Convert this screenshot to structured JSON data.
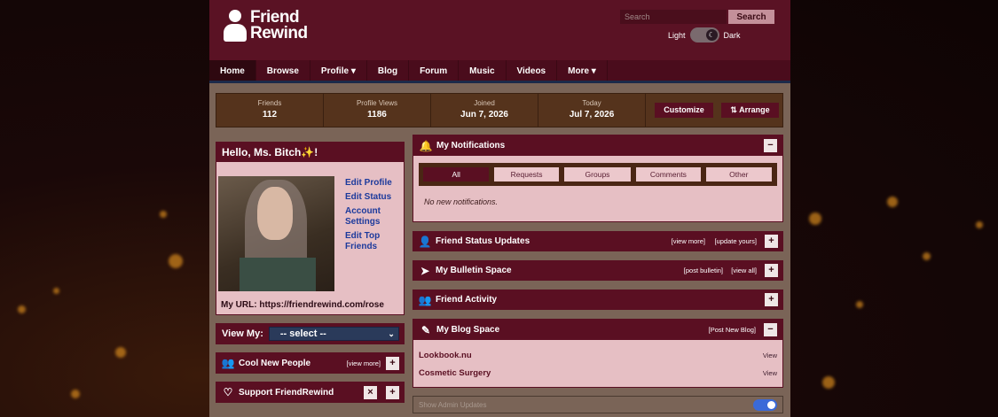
{
  "logo": {
    "line1": "Friend",
    "line2": "Rewind"
  },
  "search": {
    "placeholder": "Search",
    "button": "Search"
  },
  "theme": {
    "light": "Light",
    "dark": "Dark",
    "knob_glyph": "☾"
  },
  "nav": [
    {
      "label": "Home"
    },
    {
      "label": "Browse"
    },
    {
      "label": "Profile ▾"
    },
    {
      "label": "Blog"
    },
    {
      "label": "Forum"
    },
    {
      "label": "Music"
    },
    {
      "label": "Videos"
    },
    {
      "label": "More ▾"
    }
  ],
  "stats": [
    {
      "label": "Friends",
      "value": "112"
    },
    {
      "label": "Profile Views",
      "value": "1186"
    },
    {
      "label": "Joined",
      "value": "Jun 7, 2026"
    },
    {
      "label": "Today",
      "value": "Jul 7, 2026"
    }
  ],
  "stat_buttons": {
    "customize": "Customize",
    "arrange": "⇅ Arrange"
  },
  "hello": {
    "title": "Hello, Ms. Bitch✨!",
    "links": [
      "Edit Profile",
      "Edit Status",
      "Account Settings",
      "Edit Top Friends"
    ],
    "url_label": "My URL:",
    "url": "https://friendrewind.com/rose"
  },
  "viewmy": {
    "label": "View My:",
    "selected": "-- select --"
  },
  "cool_people": {
    "title": "Cool New People",
    "link": "[view more]"
  },
  "support": {
    "title": "Support FriendRewind"
  },
  "notifications": {
    "title": "My Notifications",
    "filters": [
      "All",
      "Requests",
      "Groups",
      "Comments",
      "Other"
    ],
    "empty": "No new notifications."
  },
  "status_updates": {
    "title": "Friend Status Updates",
    "link1": "[view more]",
    "link2": "[update yours]"
  },
  "bulletin": {
    "title": "My Bulletin Space",
    "link1": "[post bulletin]",
    "link2": "[view all]"
  },
  "activity": {
    "title": "Friend Activity"
  },
  "blog": {
    "title": "My Blog Space",
    "link": "[Post New Blog]",
    "entries": [
      {
        "title": "Lookbook.nu",
        "action": "View"
      },
      {
        "title": "Cosmetic Surgery",
        "action": "View"
      }
    ]
  },
  "admin": {
    "label": "Show Admin Updates"
  },
  "glyphs": {
    "plus": "+",
    "minus": "−",
    "close": "×"
  },
  "colors": {
    "accent": "#5a0f22",
    "panel_bg": "#e6bfc4",
    "page_bg": "#7a6457"
  }
}
